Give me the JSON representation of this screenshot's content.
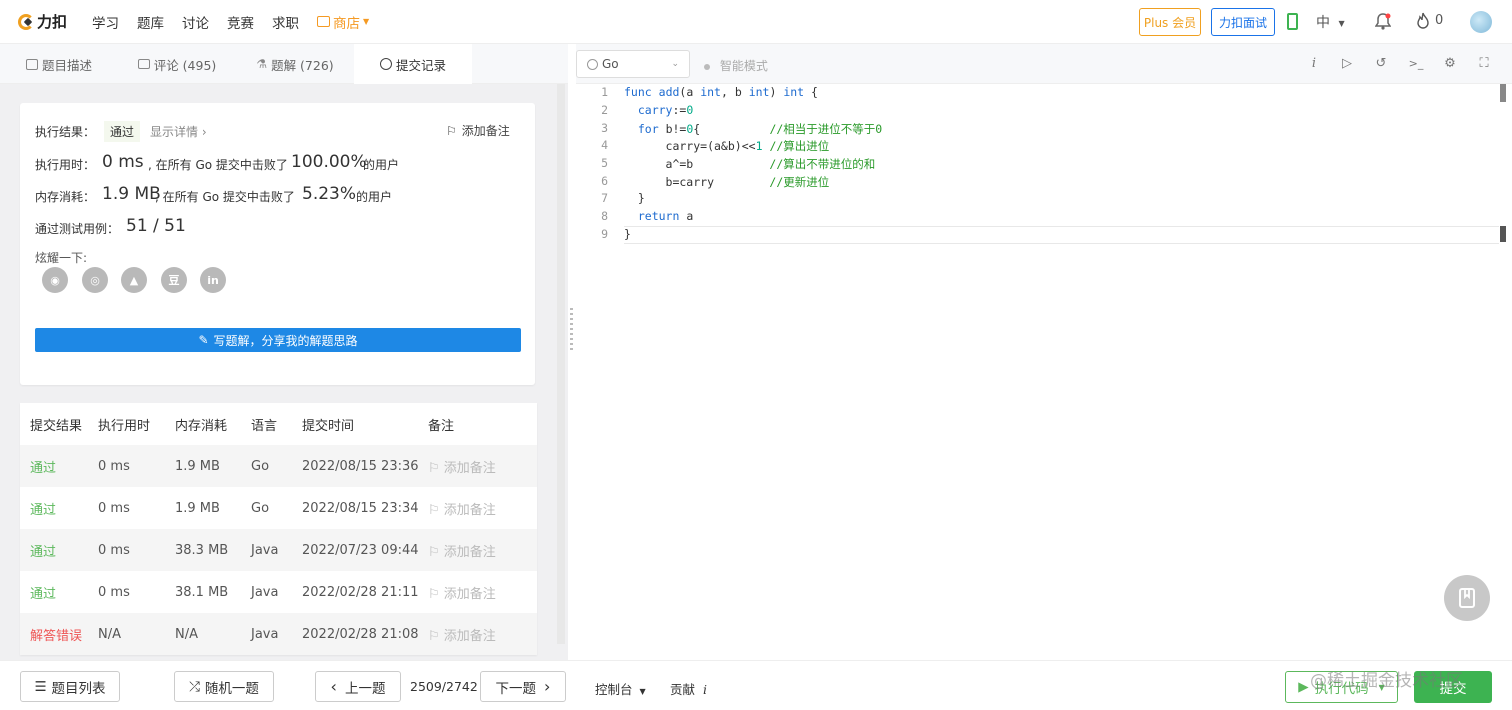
{
  "nav": {
    "logo_text": "力扣",
    "items": [
      "学习",
      "题库",
      "讨论",
      "竞赛",
      "求职"
    ],
    "shop": "商店",
    "plus": "Plus 会员",
    "interview": "力扣面试",
    "lang": "中",
    "points": "0"
  },
  "tabs": [
    {
      "label": "题目描述"
    },
    {
      "label": "评论 (495)"
    },
    {
      "label": "题解 (726)"
    },
    {
      "label": "提交记录"
    }
  ],
  "editor_bar": {
    "language": "Go",
    "smart_mode": "智能模式"
  },
  "result": {
    "label_result": "执行结果：",
    "status": "通过",
    "details": "显示详情 ›",
    "add_note": "添加备注",
    "label_time": "执行用时：",
    "time_value": "0 ms",
    "time_mid": ", 在所有 Go 提交中击败了",
    "time_percent": "100.00%",
    "time_tail": "的用户",
    "label_mem": "内存消耗：",
    "mem_value": "1.9 MB",
    "mem_mid": ", 在所有 Go 提交中击败了",
    "mem_percent": "5.23%",
    "mem_tail": "的用户",
    "label_cases": "通过测试用例：",
    "cases": "51 / 51",
    "share_label": "炫耀一下:",
    "write_button": "写题解，分享我的解题思路"
  },
  "table": {
    "headers": [
      "提交结果",
      "执行用时",
      "内存消耗",
      "语言",
      "提交时间",
      "备注"
    ],
    "rows": [
      {
        "result": "通过",
        "time": "0 ms",
        "mem": "1.9 MB",
        "lang": "Go",
        "date": "2022/08/15 23:36",
        "note": "添加备注"
      },
      {
        "result": "通过",
        "time": "0 ms",
        "mem": "1.9 MB",
        "lang": "Go",
        "date": "2022/08/15 23:34",
        "note": "添加备注"
      },
      {
        "result": "通过",
        "time": "0 ms",
        "mem": "38.3 MB",
        "lang": "Java",
        "date": "2022/07/23 09:44",
        "note": "添加备注"
      },
      {
        "result": "通过",
        "time": "0 ms",
        "mem": "38.1 MB",
        "lang": "Java",
        "date": "2022/02/28 21:11",
        "note": "添加备注"
      },
      {
        "result": "解答错误",
        "time": "N/A",
        "mem": "N/A",
        "lang": "Java",
        "date": "2022/02/28 21:08",
        "note": "添加备注"
      }
    ]
  },
  "code": {
    "line_numbers": [
      "1",
      "2",
      "3",
      "4",
      "5",
      "6",
      "7",
      "8",
      "9"
    ]
  },
  "bottom": {
    "problem_list": "题目列表",
    "random": "随机一题",
    "prev": "上一题",
    "page": "2509/2742",
    "next": "下一题",
    "console": "控制台",
    "contribute": "贡献",
    "run": "执行代码",
    "submit": "提交",
    "watermark": "@稀土掘金技术社区"
  }
}
